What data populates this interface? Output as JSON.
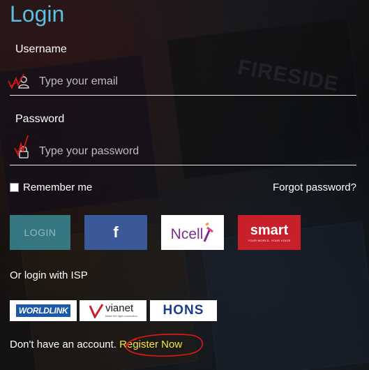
{
  "page": {
    "title": "Login"
  },
  "username": {
    "label": "Username",
    "placeholder": "Type your email"
  },
  "password": {
    "label": "Password",
    "placeholder": "Type your password"
  },
  "remember": {
    "label": "Remember me"
  },
  "forgot": {
    "label": "Forgot password?"
  },
  "social": {
    "login_label": "LOGIN",
    "facebook_label": "f",
    "ncell_label": "Ncell",
    "smart_label": "smart",
    "smart_tagline": "YOUR WORLD. YOUR VOICE"
  },
  "isp": {
    "label": "Or login with ISP",
    "worldlink": "WORLDLINK",
    "vianet": "vianet",
    "vianet_tagline": "Make the right connection",
    "hons": "HONS"
  },
  "register": {
    "prefix": "Don't have an account. ",
    "link": "Register Now"
  },
  "background": {
    "watermark": "FIRESIDE"
  },
  "colors": {
    "title": "#5bc0de",
    "login_button": "#3a8894",
    "facebook": "#3b5998",
    "ncell": "#7c2d90",
    "smart": "#c8202a",
    "register_link": "#f5e63c",
    "annotation": "#e01818"
  }
}
